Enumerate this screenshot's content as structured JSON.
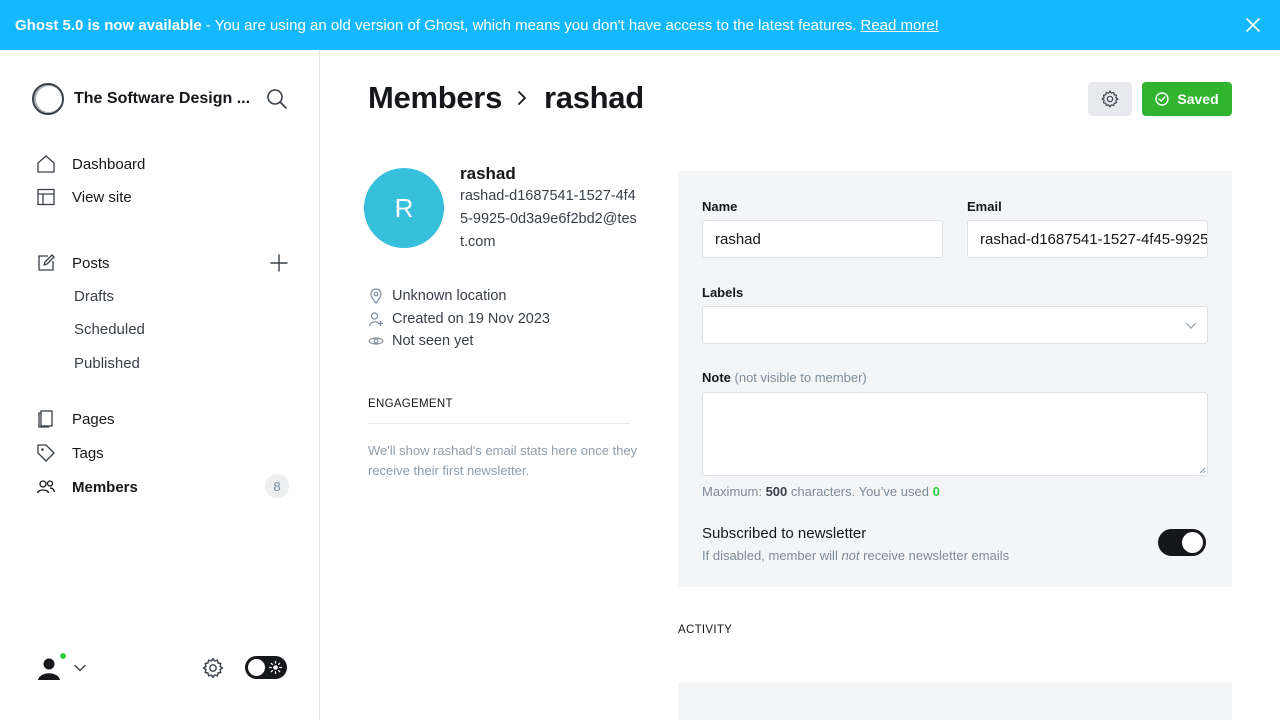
{
  "banner": {
    "strong": "Ghost 5.0 is now available",
    "message": "- You are using an old version of Ghost, which means you don't have access to the latest features.",
    "link": "Read more!",
    "color": "#14b8ff"
  },
  "sidebar": {
    "site_title": "The Software Design ...",
    "nav": {
      "dashboard": "Dashboard",
      "view_site": "View site",
      "posts": "Posts",
      "drafts": "Drafts",
      "scheduled": "Scheduled",
      "published": "Published",
      "pages": "Pages",
      "tags": "Tags",
      "members": "Members",
      "members_count": "8"
    }
  },
  "header": {
    "breadcrumb_parent": "Members",
    "breadcrumb_current": "rashad",
    "saved_label": "Saved",
    "saved_color": "#30b32e"
  },
  "member": {
    "initial": "R",
    "name": "rashad",
    "email": "rashad-d1687541-1527-4f45-9925-0d3a9e6f2bd2@test.com",
    "location": "Unknown location",
    "created": "Created on 19 Nov 2023",
    "last_seen": "Not seen yet",
    "avatar_color": "#36c0dc"
  },
  "engagement": {
    "title": "ENGAGEMENT",
    "text": "We'll show rashad's email stats here once they receive their first newsletter."
  },
  "form": {
    "name_label": "Name",
    "name_value": "rashad",
    "email_label": "Email",
    "email_value": "rashad-d1687541-1527-4f45-9925-0d3a9e6f2bd2@test.com",
    "labels_label": "Labels",
    "note_label": "Note",
    "note_hint": "(not visible to member)",
    "char_prefix": "Maximum:",
    "char_max": "500",
    "char_mid": "characters. You’ve used",
    "char_used": "0",
    "newsletter_title": "Subscribed to newsletter",
    "newsletter_desc_a": "If disabled, member will",
    "newsletter_desc_em": "not",
    "newsletter_desc_b": "receive newsletter emails",
    "newsletter_enabled": true
  },
  "activity": {
    "title": "ACTIVITY"
  }
}
